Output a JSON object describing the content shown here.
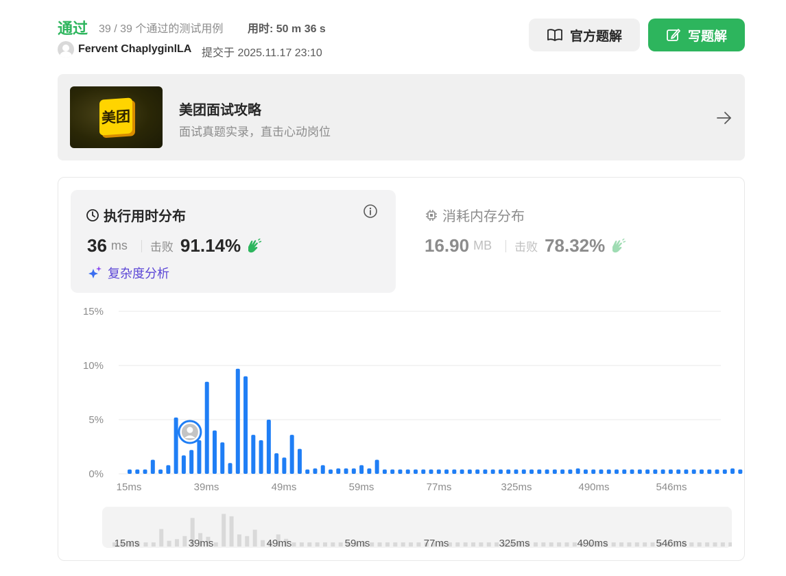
{
  "header": {
    "status": "通过",
    "cases": "39 / 39 个通过的测试用例",
    "time_label": "用时: 50 m 36 s",
    "user_name": "Fervent ChaplyginlLA",
    "submitted": "提交于 2025.11.17 23:10",
    "official_solution": "官方题解",
    "write_solution": "写题解"
  },
  "banner": {
    "logo_text": "美团",
    "title": "美团面试攻略",
    "subtitle": "面试真题实录，直击心动岗位"
  },
  "runtime": {
    "title": "执行用时分布",
    "value": "36",
    "unit": "ms",
    "beat_label": "击败",
    "beat_pct": "91.14%",
    "complexity": "复杂度分析"
  },
  "memory": {
    "title": "消耗内存分布",
    "value": "16.90",
    "unit": "MB",
    "beat_label": "击败",
    "beat_pct": "78.32%"
  },
  "colors": {
    "accent_green": "#2db55d",
    "bar_blue": "#1f7ef5",
    "complexity_purple": "#5b46d6"
  },
  "chart_data": {
    "type": "bar",
    "title": "",
    "xlabel": "",
    "ylabel": "",
    "ylim": [
      0,
      15
    ],
    "yticks": [
      "0%",
      "5%",
      "10%",
      "15%"
    ],
    "xtick_labels": [
      "15ms",
      "39ms",
      "49ms",
      "59ms",
      "77ms",
      "325ms",
      "490ms",
      "546ms"
    ],
    "highlight_index": 7,
    "values": [
      0.4,
      0.4,
      0.4,
      1.3,
      0.4,
      0.8,
      5.2,
      1.7,
      2.2,
      3.1,
      8.5,
      4.0,
      2.9,
      1.0,
      9.7,
      9.0,
      3.6,
      3.1,
      5.0,
      1.9,
      1.5,
      3.6,
      2.3,
      0.4,
      0.5,
      0.8,
      0.4,
      0.5,
      0.5,
      0.5,
      0.8,
      0.5,
      1.3,
      0.4,
      0.4,
      0.4,
      0.4,
      0.4,
      0.4,
      0.4,
      0.4,
      0.4,
      0.4,
      0.4,
      0.4,
      0.4,
      0.4,
      0.4,
      0.4,
      0.4,
      0.4,
      0.4,
      0.4,
      0.4,
      0.4,
      0.4,
      0.4,
      0.4,
      0.5,
      0.4,
      0.4,
      0.4,
      0.4,
      0.4,
      0.4,
      0.4,
      0.4,
      0.4,
      0.4,
      0.4,
      0.4,
      0.4,
      0.4,
      0.4,
      0.4,
      0.4,
      0.4,
      0.4,
      0.5,
      0.4,
      0.4,
      0.4
    ]
  }
}
